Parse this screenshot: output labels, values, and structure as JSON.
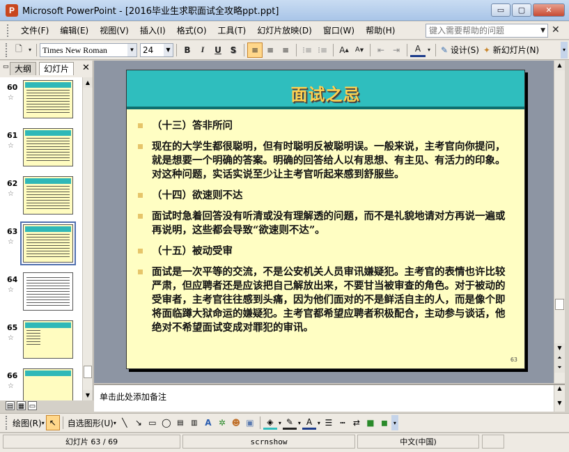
{
  "window": {
    "title": "Microsoft PowerPoint - [2016毕业生求职面试全攻略ppt.ppt]",
    "app_icon": "powerpoint-icon",
    "btn_minimize": "▭",
    "btn_restore": "▢",
    "btn_close": "✕"
  },
  "menu": {
    "items": [
      "文件(F)",
      "编辑(E)",
      "视图(V)",
      "插入(I)",
      "格式(O)",
      "工具(T)",
      "幻灯片放映(D)",
      "窗口(W)",
      "帮助(H)"
    ],
    "help_placeholder": "键入需要帮助的问题",
    "close_glyph": "✕"
  },
  "toolbar": {
    "font_name": "Times New Roman",
    "font_size": "24",
    "bold": "B",
    "italic": "I",
    "underline": "U",
    "shadow": "S",
    "design_label": "设计(S)",
    "new_slide_label": "新幻灯片(N)"
  },
  "left_pane": {
    "tab_outline": "大纲",
    "tab_slides": "幻灯片",
    "close_glyph": "✕",
    "thumbnails": [
      {
        "num": "60"
      },
      {
        "num": "61"
      },
      {
        "num": "62"
      },
      {
        "num": "63"
      },
      {
        "num": "64"
      },
      {
        "num": "65"
      },
      {
        "num": "66"
      }
    ],
    "selected_num": "63"
  },
  "slide": {
    "title": "面试之忌",
    "bullets": [
      "（十三）答非所问",
      "现在的大学生都很聪明，但有时聪明反被聪明误。一般来说，主考官向你提问，就是想要一个明确的答案。明确的回答给人以有思想、有主见、有活力的印象。对这种问题，实话实说至少让主考官听起来感到舒服些。",
      "（十四）欲速则不达",
      "面试时急着回答没有听清或没有理解透的问题，而不是礼貌地请对方再说一遍或再说明，这些都会导致“欲速则不达”。",
      "（十五）被动受审",
      "面试是一次平等的交流，不是公安机关人员审讯嫌疑犯。主考官的表情也许比较严肃，但应聘者还是应该把自己解放出来，不要甘当被审查的角色。对于被动的受审者，主考官往往感到头痛，因为他们面对的不是鲜活自主的人，而是像个即将面临蹲大狱命运的嫌疑犯。主考官都希望应聘者积极配合，主动参与谈话，他绝对不希望面试变成对罪犯的审讯。"
    ],
    "page_number": "63"
  },
  "notes": {
    "placeholder": "单击此处添加备注"
  },
  "drawbar": {
    "draw_label": "绘图(R)",
    "autoshapes_label": "自选图形(U)"
  },
  "status": {
    "slide_info": "幻灯片 63 / 69",
    "design_name": "scrnshow",
    "language": "中文(中国)"
  },
  "colors": {
    "title_band": "#2fbebe",
    "title_text": "#ffd050",
    "slide_bg": "#fffec3",
    "bullet": "#e6c56a"
  }
}
